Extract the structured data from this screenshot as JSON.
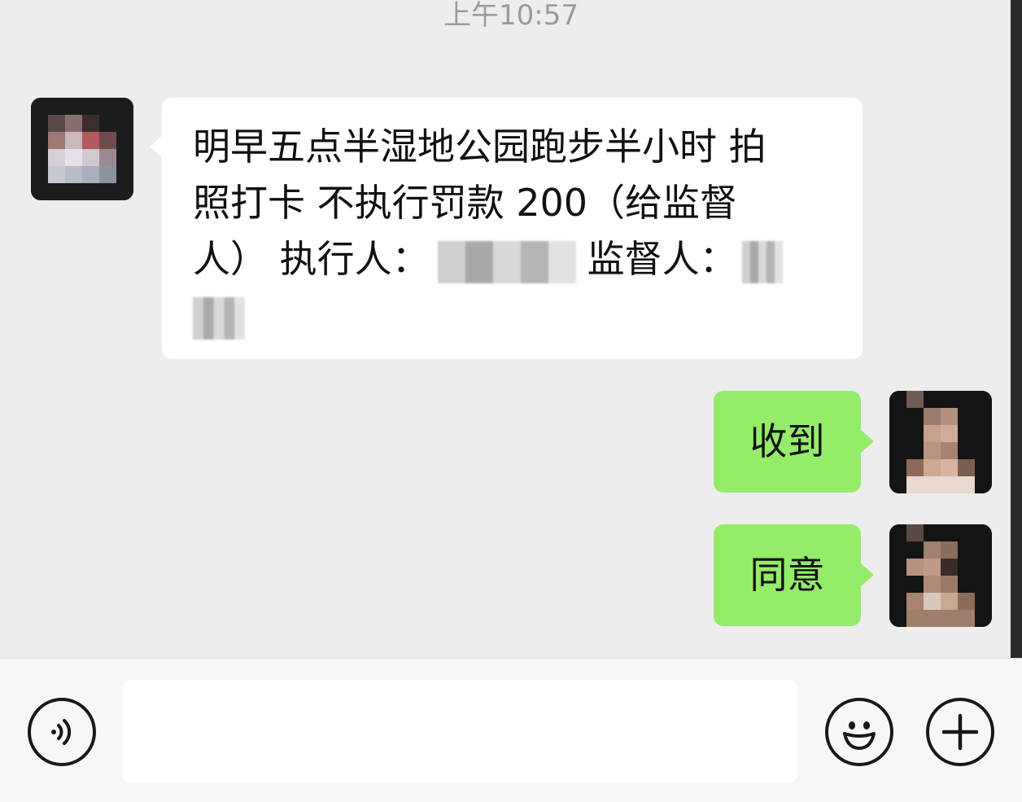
{
  "timestamp": "上午10:57",
  "messages": [
    {
      "direction": "incoming",
      "lines": [
        "明早五点半湿地公园跑步半小时 拍",
        "照打卡 不执行罚款 200（给监督",
        "人） 执行人：",
        "监督人："
      ]
    },
    {
      "direction": "outgoing",
      "text": "收到"
    },
    {
      "direction": "outgoing",
      "text": "同意"
    }
  ],
  "input_bar": {
    "voice_icon": "voice-icon",
    "emoji_icon": "emoji-icon",
    "plus_icon": "plus-icon",
    "input_value": ""
  },
  "colors": {
    "background": "#ededed",
    "incoming_bubble": "#ffffff",
    "outgoing_bubble": "#95ec69",
    "timestamp": "#9b9b9b"
  }
}
